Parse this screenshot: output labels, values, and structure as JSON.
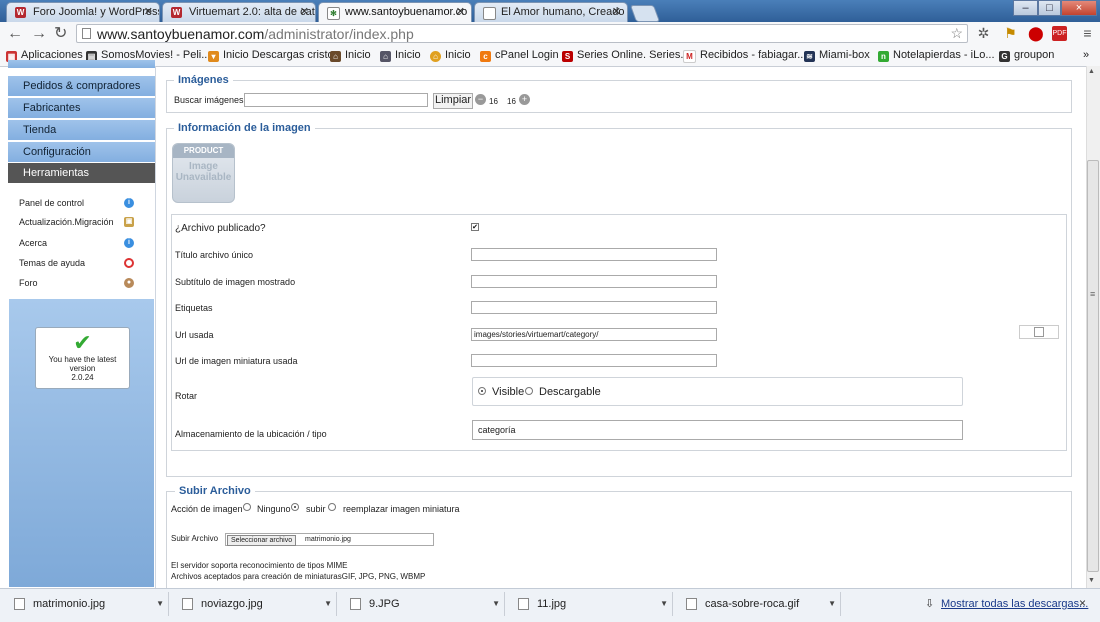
{
  "browser": {
    "tabs": [
      {
        "title": "Foro Joomla! y WordPress",
        "favicon": "joomla-icon"
      },
      {
        "title": "Virtuemart 2.0: alta de cat",
        "favicon": "joomla-icon"
      },
      {
        "title": "www.santoybuenamor.co",
        "favicon": "joomla-icon"
      },
      {
        "title": "El Amor humano, Creado",
        "favicon": "page-icon"
      }
    ],
    "active_tab": 2,
    "window_controls": [
      "–",
      "□",
      "×"
    ],
    "url_host": "www.santoybuenamor.com",
    "url_path": "/administrator/index.php",
    "bookmarks": [
      {
        "label": "Aplicaciones",
        "icon": "apps-icon"
      },
      {
        "label": "SomosMovies! - Peli...",
        "icon": "film-icon"
      },
      {
        "label": "Inicio Descargas cristo",
        "icon": "download-icon"
      },
      {
        "label": "Inicio",
        "icon": "home-icon"
      },
      {
        "label": "Inicio",
        "icon": "home-icon"
      },
      {
        "label": "Inicio",
        "icon": "home-icon"
      },
      {
        "label": "cPanel Login",
        "icon": "cpanel-icon"
      },
      {
        "label": "Series Online. Series...",
        "icon": "series-icon"
      },
      {
        "label": "Recibidos - fabiagar...",
        "icon": "gmail-icon"
      },
      {
        "label": "Miami-box",
        "icon": "box-icon"
      },
      {
        "label": "Notelapierdas - iLo...",
        "icon": "news-icon"
      },
      {
        "label": "groupon",
        "icon": "groupon-icon"
      }
    ]
  },
  "sidebar": {
    "menu": [
      "Pedidos & compradores",
      "Fabricantes",
      "Tienda",
      "Configuración",
      "Herramientas"
    ],
    "submenu": [
      {
        "label": "Panel de control",
        "icon": "info-icon"
      },
      {
        "label": "Actualización.Migración",
        "icon": "package-icon"
      },
      {
        "label": "Acerca",
        "icon": "info-icon"
      },
      {
        "label": "Temas de ayuda",
        "icon": "lifebuoy-icon"
      },
      {
        "label": "Foro",
        "icon": "users-icon"
      }
    ],
    "version": {
      "line1": "You have the latest",
      "line2": "version",
      "number": "2.0.24"
    }
  },
  "imagenes": {
    "legend": "Imágenes",
    "search_label": "Buscar imágenes",
    "search_value": "",
    "clear_label": "Limpiar",
    "page_prev": "16",
    "page_next": "16"
  },
  "info": {
    "legend": "Información de la imagen",
    "placeholder_top": "PRODUCT",
    "placeholder_mid": "Image",
    "placeholder_bot": "Unavailable",
    "published_label": "¿Archivo publicado?",
    "published_checked": true,
    "title_label": "Título archivo único",
    "title_value": "",
    "subtitle_label": "Subtítulo de imagen mostrado",
    "subtitle_value": "",
    "tags_label": "Etiquetas",
    "tags_value": "",
    "url_label": "Url usada",
    "url_value": "images/stories/virtuemart/category/",
    "thumb_label": "Url de imagen miniatura usada",
    "thumb_value": "",
    "rotate_label": "Rotar",
    "option_visible": "Visible",
    "option_downloadable": "Descargable",
    "storage_label": "Almacenamiento de la ubicación / tipo",
    "storage_value": "categoría"
  },
  "upload": {
    "legend": "Subir Archivo",
    "action_label": "Acción de imagen",
    "opt_none": "Ninguno",
    "opt_upload": "subir",
    "opt_replace": "reemplazar imagen miniatura",
    "file_label": "Subir Archivo",
    "file_button": "Seleccionar archivo",
    "file_name": "matrimonio.jpg",
    "note1": "El servidor soporta reconocimiento de tipos MIME",
    "note2": "Archivos aceptados para creación de miniaturasGIF, JPG, PNG, WBMP"
  },
  "downloads": {
    "items": [
      "matrimonio.jpg",
      "noviazgo.jpg",
      "9.JPG",
      "11.jpg",
      "casa-sobre-roca.gif"
    ],
    "show_all": "Mostrar todas las descargas...",
    "close": "×"
  }
}
